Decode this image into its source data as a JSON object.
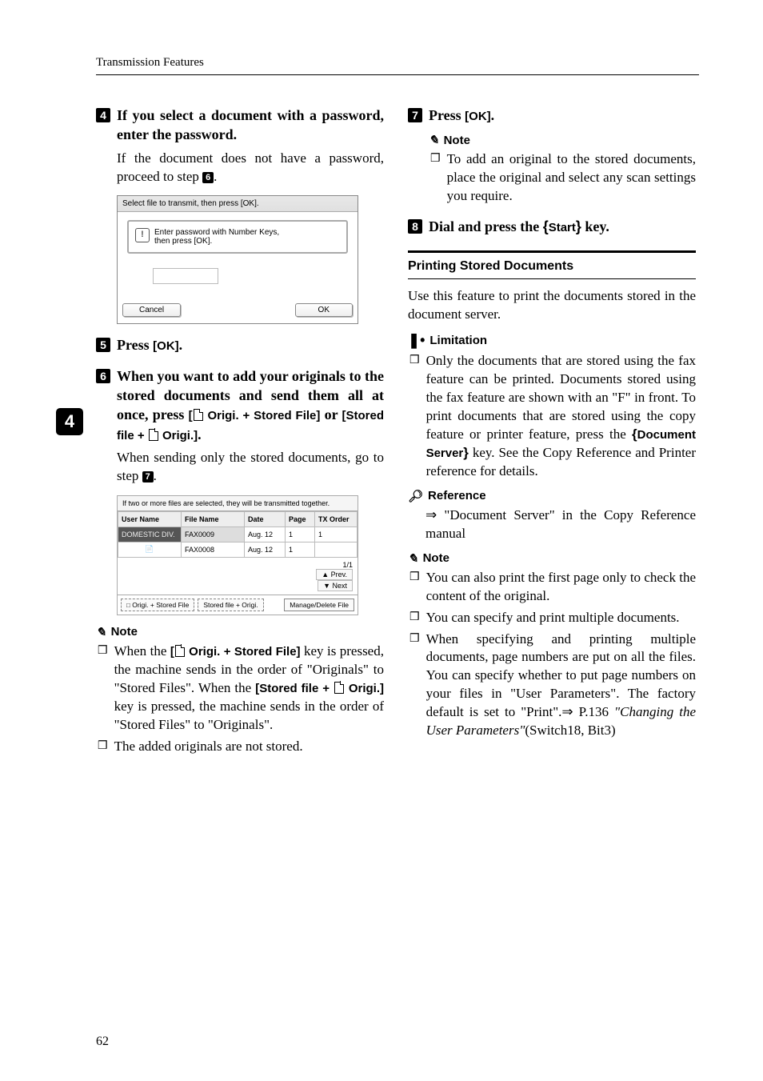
{
  "header": {
    "section": "Transmission Features"
  },
  "side_tab": "4",
  "left": {
    "step4": {
      "heading": "If you select a document with a password, enter the password.",
      "body": "If the document does not have a password, proceed to step "
    },
    "shot1": {
      "title": "Select file to transmit, then press [OK].",
      "panel1": "Enter password with Number Keys,",
      "panel2": "then press [OK].",
      "cancel": "Cancel",
      "ok": "OK"
    },
    "step5": {
      "heading": "Press ",
      "ui": "[OK]",
      "tail": "."
    },
    "step6": {
      "heading_a": "When you want to add your originals to the stored documents and send them all at once, press ",
      "ui_a": "[",
      "ui_a_tail": " Origi. + Stored File]",
      "mid": " or ",
      "ui_b": "[Stored file + ",
      "ui_b_tail": " Origi.]",
      "tail": ".",
      "body": "When sending only the stored documents, go to step "
    },
    "shot2": {
      "hdr": "If two or more files are selected, they will be transmitted together.",
      "col_user": "User Name",
      "col_file": "File Name",
      "col_date": "Date",
      "col_page": "Page",
      "col_txo": "TX Order",
      "r1_user": "DOMESTIC DIV.",
      "r1_file": "FAX0009",
      "r1_date": "Aug.   12",
      "r1_page": "1",
      "r1_txo": "1",
      "r2_file": "FAX0008",
      "r2_date": "Aug.   12",
      "r2_page": "1",
      "page_ind": "1/1",
      "prev": "▲ Prev.",
      "next": "▼ Next",
      "fbtn1": " Origi. + Stored File",
      "fbtn2": "Stored file +  Origi.",
      "fbtn3": "Manage/Delete File"
    },
    "note": {
      "title": "Note",
      "items": [
        {
          "pre": "When the ",
          "ui1": "[",
          "ui1_tail": " Origi. + Stored File]",
          "mid1": " key is pressed, the machine sends in the order of \"Originals\" to \"Stored Files\". When the ",
          "ui2": "[Stored file + ",
          "ui2_tail": "  Origi.]",
          "mid2": " key is pressed, the machine sends in the order of \"Stored Files\" to \"Originals\"."
        },
        {
          "text": "The added originals are not stored."
        }
      ]
    }
  },
  "right": {
    "step7": {
      "heading": "Press ",
      "ui": "[OK]",
      "tail": "."
    },
    "note7": {
      "title": "Note",
      "item": "To add an original to the stored documents, place the original and select any scan settings you require."
    },
    "step8": {
      "heading": "Dial and press the ",
      "key_open": "{",
      "key_label": "Start",
      "key_close": "}",
      "tail": " key."
    },
    "subhead": "Printing Stored Documents",
    "intro": "Use this feature to print the documents stored in the document server.",
    "limit": {
      "title": "Limitation",
      "item_a": "Only the documents that are stored using the fax feature can be printed. Documents stored using the fax feature are shown with an \"F\" in front. To print documents that are stored using the copy feature or printer feature, press the ",
      "key_open": "{",
      "key_label": "Document Server",
      "key_close": "}",
      "item_b": " key. See the Copy Reference and Printer reference for details."
    },
    "reference": {
      "title": "Reference",
      "body": "⇒ \"Document Server\" in the Copy Reference manual"
    },
    "note2": {
      "title": "Note",
      "items": [
        "You can also print the first page only to check the content of the original.",
        "You can specify and print multiple documents."
      ],
      "item3_a": "When specifying and printing multiple documents, page numbers are put on all the files. You can specify whether to put page numbers on your files in \"User Parameters\".  The factory default is set to \"Print\".⇒ P.136 ",
      "item3_i": "\"Changing the User Parameters\"",
      "item3_b": "(Switch18, Bit3)"
    }
  },
  "page_number": "62"
}
